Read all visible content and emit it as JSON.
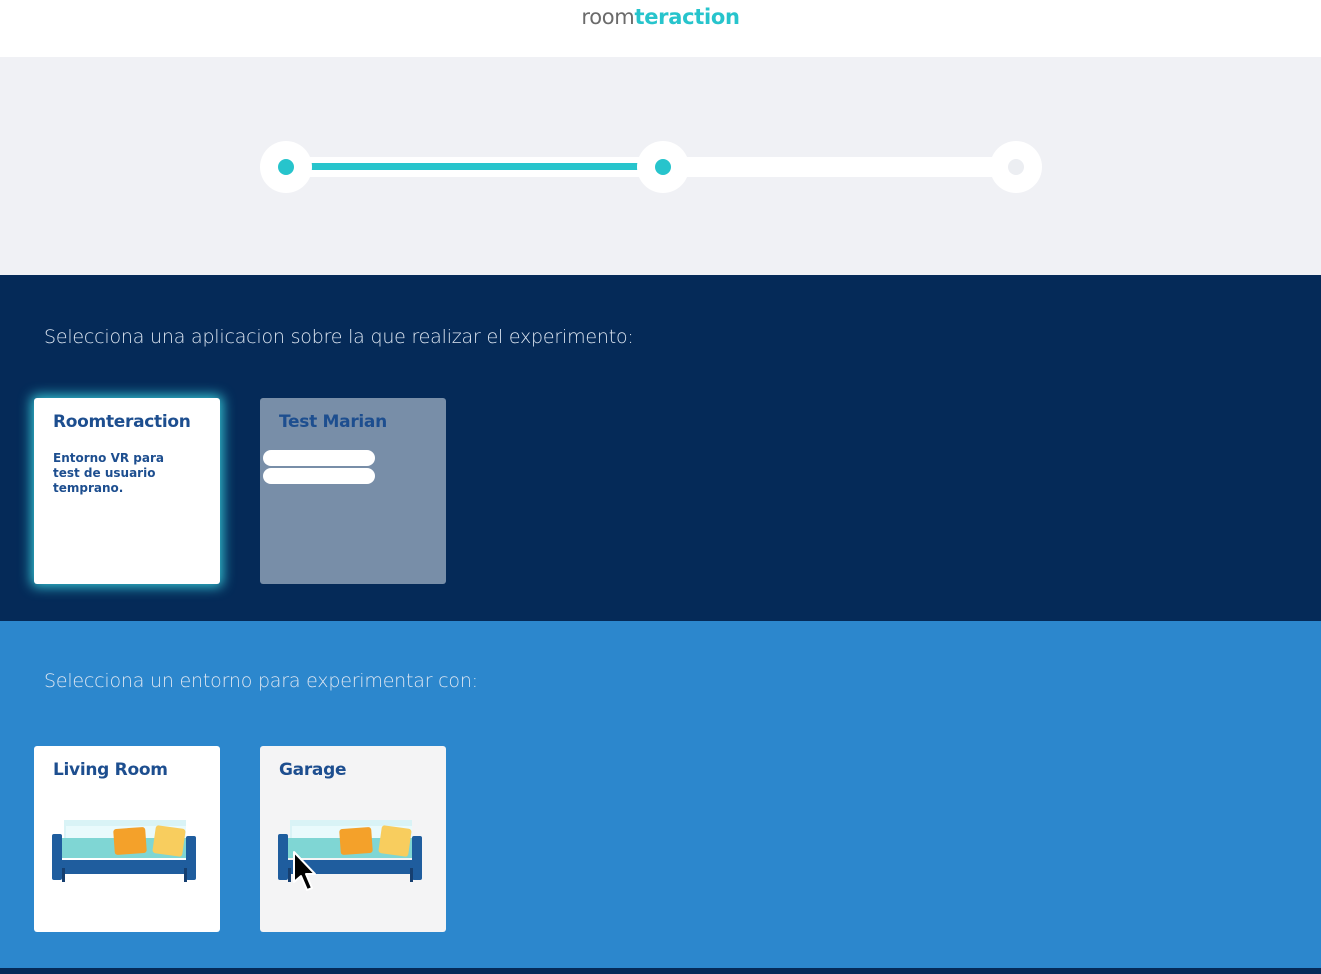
{
  "header": {
    "logo_part1": "room",
    "logo_part2": "teraction"
  },
  "stepper": {
    "steps_total": 3,
    "current_step": 2,
    "progress_fraction": 0.5
  },
  "apps_section": {
    "prompt": "Selecciona una aplicacion sobre la que realizar el experimento:",
    "apps": [
      {
        "name": "Roomteraction",
        "description": "Entorno VR para test de usuario temprano.",
        "selected": true
      },
      {
        "name": "Test Marian",
        "description": "",
        "selected": false
      }
    ]
  },
  "envs_section": {
    "prompt": "Selecciona un entorno para experimentar con:",
    "environments": [
      {
        "name": "Living Room",
        "icon": "sofa-icon"
      },
      {
        "name": "Garage",
        "icon": "sofa-icon"
      }
    ]
  },
  "colors": {
    "accent": "#27c4cc",
    "dark_navy": "#052a58",
    "mid_blue": "#2c87cd",
    "title_blue": "#1d4e8f"
  }
}
